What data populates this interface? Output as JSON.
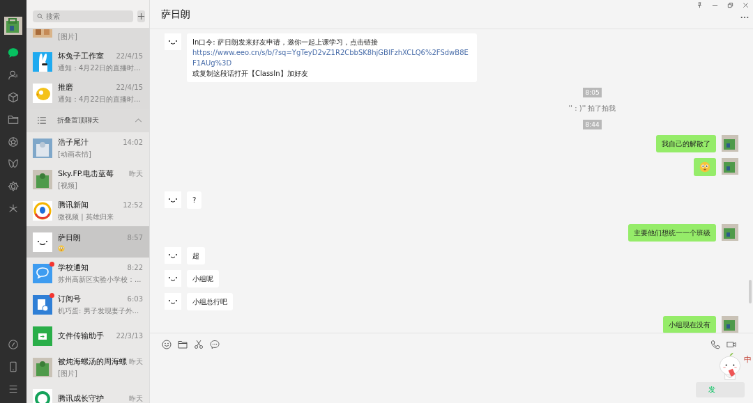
{
  "nav": [
    {
      "kind": "chat",
      "selected": true
    },
    {
      "kind": "contacts",
      "selected": false
    },
    {
      "kind": "cube",
      "selected": false
    },
    {
      "kind": "folder",
      "selected": false
    },
    {
      "kind": "aperture",
      "selected": false
    },
    {
      "kind": "butterfly",
      "selected": false
    },
    {
      "kind": "gear",
      "selected": false
    },
    {
      "kind": "sparkle",
      "selected": false
    }
  ],
  "nav_bottom": [
    {
      "kind": "link"
    },
    {
      "kind": "phone"
    },
    {
      "kind": "menu"
    }
  ],
  "search": {
    "placeholder": "搜索"
  },
  "pinned_chats": [
    {
      "preview": "[图片]"
    },
    {
      "kind": "rabbit",
      "name": "坏兔子工作室",
      "preview": "通知：4月22日的直播时...",
      "time": "22/4/15"
    },
    {
      "kind": "chick",
      "name": "推磨",
      "preview": "通知：4月22日的直播时...",
      "time": "22/4/15"
    }
  ],
  "fold_row": {
    "label": "折叠置顶聊天",
    "expanded": true
  },
  "chats": [
    {
      "name": "浩子尾汁",
      "preview": "[动画表情]",
      "time": "14:02",
      "selected": false,
      "unread": false
    },
    {
      "name": "Sky.FP.电击蓝莓",
      "preview": "[视频]",
      "time": "昨天",
      "selected": false,
      "unread": false
    },
    {
      "kind": "news",
      "name": "腾讯新闻",
      "preview": "微视频 | 英雄归来",
      "time": "12:52",
      "selected": false,
      "unread": false
    },
    {
      "kind": "smile",
      "name": "萨日朗",
      "preview": {
        "kind": "emoji"
      },
      "time": "8:57",
      "selected": true,
      "unread": false
    },
    {
      "kind": "bubble",
      "name": "学校通知",
      "preview": "苏州高新区实验小学校：...",
      "time": "8:22",
      "selected": false,
      "unread": true
    },
    {
      "kind": "subscribe",
      "name": "订阅号",
      "preview": "机巧蛋: 男子发现妻子外...",
      "time": "6:03",
      "selected": false,
      "unread": true
    },
    {
      "kind": "file",
      "name": "文件传输助手",
      "time": "22/3/13",
      "selected": false,
      "unread": false
    },
    {
      "name": "被炖海螺汤的周海螺",
      "preview": "[图片]",
      "time": "昨天",
      "selected": false,
      "unread": false
    },
    {
      "kind": "ring",
      "name": "腾讯成长守护",
      "time": "昨天",
      "selected": false,
      "unread": false
    }
  ],
  "chat": {
    "title": "萨日朗"
  },
  "messages": [
    {
      "kind": "text",
      "outgoing": false,
      "text": "In口令: 萨日朗发来好友申请，邀你一起上课学习，点击链接 ",
      "link": "https://www.eeo.cn/s/b/?sq=YgTeyD2vZ1R2CbbSK8hjGBlFzhXCLQ6%2FSdwB8EF1AUg%3D",
      "after": " 或复制这段话打开【ClassIn】加好友"
    },
    {
      "kind": "time",
      "text": "8:05"
    },
    {
      "kind": "system",
      "text": "'' : )'' 拍了拍我"
    },
    {
      "kind": "time",
      "text": "8:44"
    },
    {
      "kind": "text",
      "outgoing": true,
      "text": "我自己的解散了"
    },
    {
      "kind": "emoji",
      "outgoing": true
    },
    {
      "kind": "text",
      "outgoing": false,
      "text": "?"
    },
    {
      "kind": "text",
      "outgoing": true,
      "text": "主要他们想统一一个班级"
    },
    {
      "kind": "text",
      "outgoing": false,
      "text": "超"
    },
    {
      "kind": "text",
      "outgoing": false,
      "text": "小组呢"
    },
    {
      "kind": "text",
      "outgoing": false,
      "text": "小组总行吧"
    },
    {
      "kind": "text",
      "outgoing": true,
      "text": "小组现在没有"
    }
  ],
  "composer": {
    "send_label": "发",
    "ime_label": "中"
  }
}
